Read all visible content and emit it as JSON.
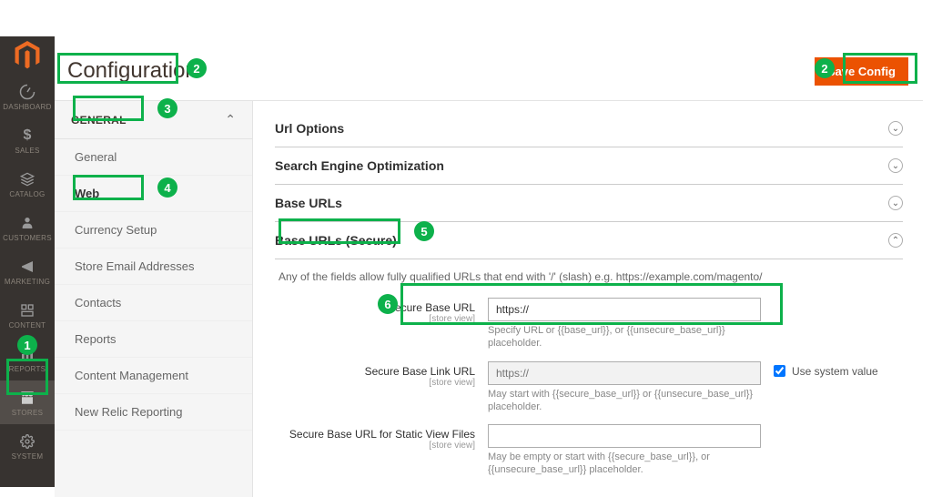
{
  "page": {
    "title": "Configuration",
    "save_label": "Save Config"
  },
  "nav": {
    "items": [
      {
        "label": "DASHBOARD"
      },
      {
        "label": "SALES"
      },
      {
        "label": "CATALOG"
      },
      {
        "label": "CUSTOMERS"
      },
      {
        "label": "MARKETING"
      },
      {
        "label": "CONTENT"
      },
      {
        "label": "REPORTS"
      },
      {
        "label": "STORES"
      },
      {
        "label": "SYSTEM"
      }
    ]
  },
  "config_nav": {
    "group": "GENERAL",
    "items": [
      {
        "label": "General"
      },
      {
        "label": "Web"
      },
      {
        "label": "Currency Setup"
      },
      {
        "label": "Store Email Addresses"
      },
      {
        "label": "Contacts"
      },
      {
        "label": "Reports"
      },
      {
        "label": "Content Management"
      },
      {
        "label": "New Relic Reporting"
      }
    ]
  },
  "sections": {
    "url_options": "Url Options",
    "seo": "Search Engine Optimization",
    "base_urls": "Base URLs",
    "base_urls_secure": "Base URLs (Secure)",
    "secure_note": "Any of the fields allow fully qualified URLs that end with '/' (slash) e.g. https://example.com/magento/"
  },
  "fields": {
    "secure_base_url": {
      "label": "Secure Base URL",
      "scope": "[store view]",
      "value": "https://",
      "hint": "Specify URL or {{base_url}}, or {{unsecure_base_url}} placeholder."
    },
    "secure_base_link_url": {
      "label": "Secure Base Link URL",
      "scope": "[store view]",
      "placeholder": "https://",
      "hint": "May start with {{secure_base_url}} or {{unsecure_base_url}} placeholder.",
      "use_system": "Use system value"
    },
    "secure_base_static": {
      "label": "Secure Base URL for Static View Files",
      "scope": "[store view]",
      "hint": "May be empty or start with {{secure_base_url}}, or {{unsecure_base_url}} placeholder."
    }
  },
  "badges": {
    "b1": "1",
    "b2a": "2",
    "b2b": "2",
    "b3": "3",
    "b4": "4",
    "b5": "5",
    "b6": "6"
  }
}
